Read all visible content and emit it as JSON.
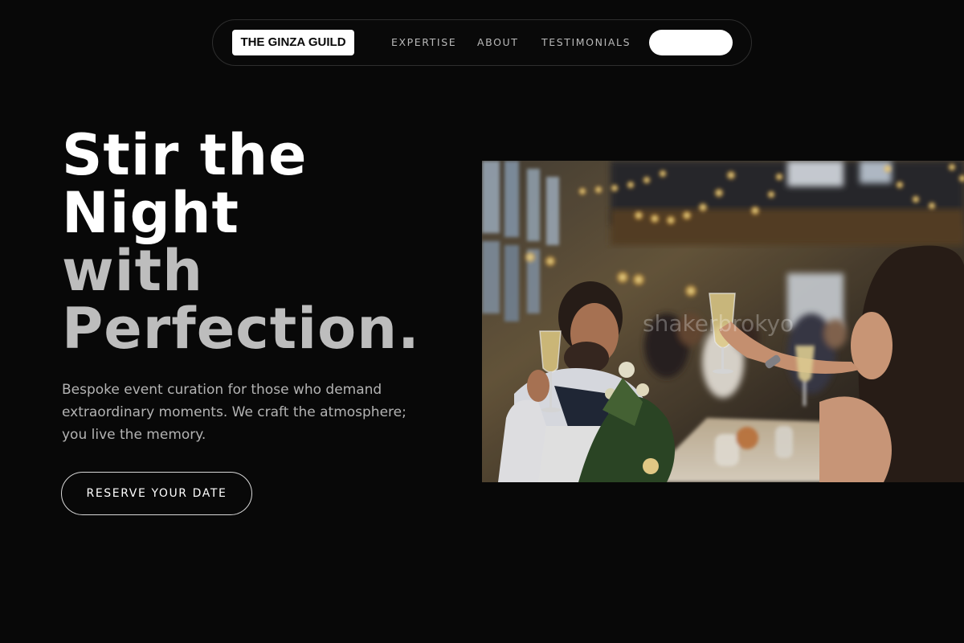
{
  "nav": {
    "logo": "THE GINZA GUILD",
    "links": [
      {
        "label": "EXPERTISE"
      },
      {
        "label": "ABOUT"
      },
      {
        "label": "TESTIMONIALS"
      }
    ],
    "cta_label": ""
  },
  "hero": {
    "headline_lines": [
      "Stir the",
      "Night",
      "with",
      "Perfection."
    ],
    "subtitle": "Bespoke event curation for those who demand extraordinary moments. We craft the atmosphere; you live the memory.",
    "button_label": "RESERVE YOUR DATE"
  },
  "photo": {
    "watermark": "shakerbrokyo"
  },
  "colors": {
    "background": "#080808",
    "headline_primary": "#ffffff",
    "headline_secondary": "#bdbdbd",
    "body_text": "#b3b3b3",
    "nav_border": "#2e2e2e"
  }
}
